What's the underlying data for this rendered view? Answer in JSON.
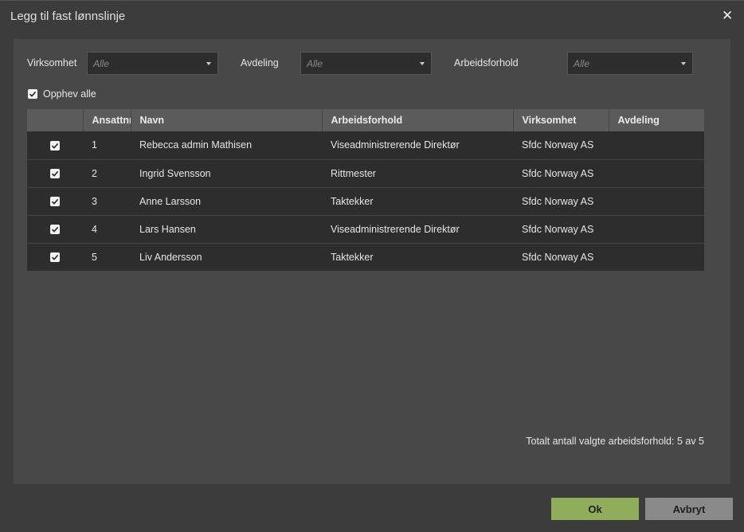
{
  "dialog": {
    "title": "Legg til fast lønnslinje"
  },
  "filters": [
    {
      "label": "Virksomhet",
      "placeholder": "Alle"
    },
    {
      "label": "Avdeling",
      "placeholder": "Alle"
    },
    {
      "label": "Arbeidsforhold",
      "placeholder": "Alle"
    }
  ],
  "toggle_all": {
    "label": "Opphev alle",
    "checked": true
  },
  "table": {
    "columns": [
      "",
      "Ansattnr",
      "Navn",
      "Arbeidsforhold",
      "Virksomhet",
      "Avdeling"
    ],
    "rows": [
      {
        "checked": true,
        "nr": "1",
        "navn": "Rebecca admin Mathisen",
        "arbeidsforhold": "Viseadministrerende Direktør",
        "virksomhet": "Sfdc Norway AS",
        "avdeling": ""
      },
      {
        "checked": true,
        "nr": "2",
        "navn": "Ingrid Svensson",
        "arbeidsforhold": "Rittmester",
        "virksomhet": "Sfdc Norway AS",
        "avdeling": ""
      },
      {
        "checked": true,
        "nr": "3",
        "navn": "Anne Larsson",
        "arbeidsforhold": "Taktekker",
        "virksomhet": "Sfdc Norway AS",
        "avdeling": ""
      },
      {
        "checked": true,
        "nr": "4",
        "navn": "Lars Hansen",
        "arbeidsforhold": "Viseadministrerende Direktør",
        "virksomhet": "Sfdc Norway AS",
        "avdeling": ""
      },
      {
        "checked": true,
        "nr": "5",
        "navn": "Liv Andersson",
        "arbeidsforhold": "Taktekker",
        "virksomhet": "Sfdc Norway AS",
        "avdeling": ""
      }
    ]
  },
  "summary": {
    "text": "Totalt antall valgte arbeidsforhold: 5 av 5"
  },
  "buttons": {
    "ok": "Ok",
    "cancel": "Avbryt"
  },
  "icons": {
    "close": "close-icon",
    "check": "check-icon",
    "caret": "caret-down-icon"
  },
  "colors": {
    "ok_button": "#8fad5a",
    "cancel_button": "#8a8a8a",
    "header_bg": "#5b5b5b",
    "row_bg": "#2d2d2d"
  }
}
